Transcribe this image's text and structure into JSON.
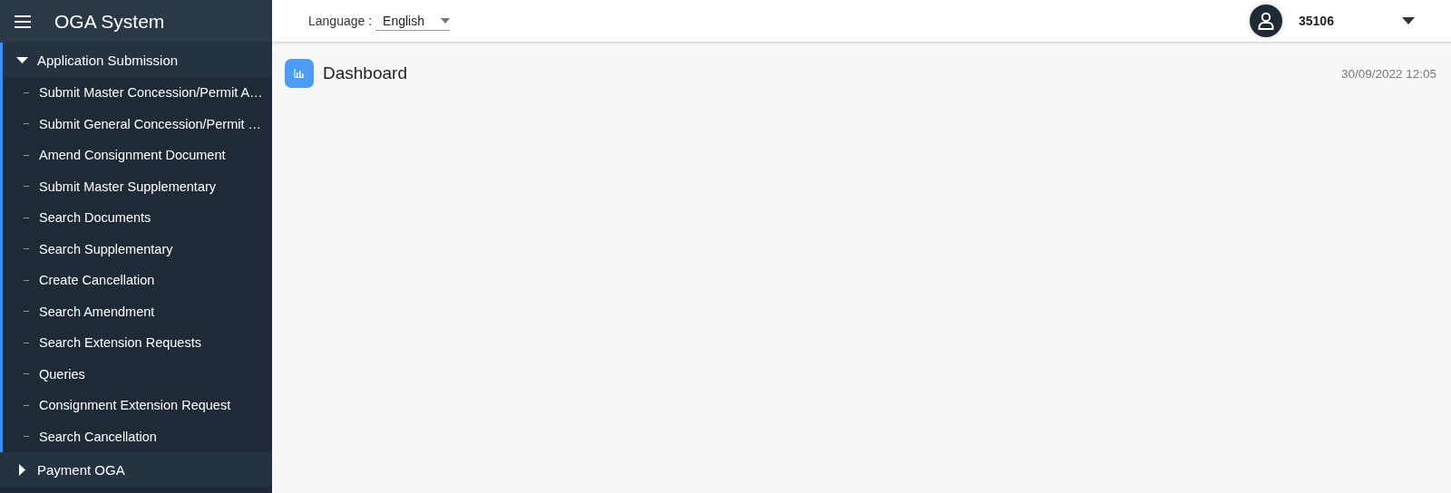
{
  "app_title": "OGA System",
  "language": {
    "label": "Language :",
    "value": "English"
  },
  "user": {
    "name": "35106"
  },
  "sidebar": {
    "groups": [
      {
        "label": "Application Submission",
        "expanded": true,
        "items": [
          {
            "label": "Submit Master Concession/Permit A…"
          },
          {
            "label": "Submit General Concession/Permit …"
          },
          {
            "label": "Amend Consignment Document"
          },
          {
            "label": "Submit Master Supplementary"
          },
          {
            "label": "Search Documents"
          },
          {
            "label": "Search Supplementary"
          },
          {
            "label": "Create Cancellation"
          },
          {
            "label": "Search Amendment"
          },
          {
            "label": "Search Extension Requests"
          },
          {
            "label": "Queries"
          },
          {
            "label": "Consignment Extension Request"
          },
          {
            "label": "Search Cancellation"
          }
        ]
      },
      {
        "label": "Payment OGA",
        "expanded": false
      }
    ]
  },
  "page": {
    "title": "Dashboard",
    "timestamp": "30/09/2022 12:05"
  }
}
